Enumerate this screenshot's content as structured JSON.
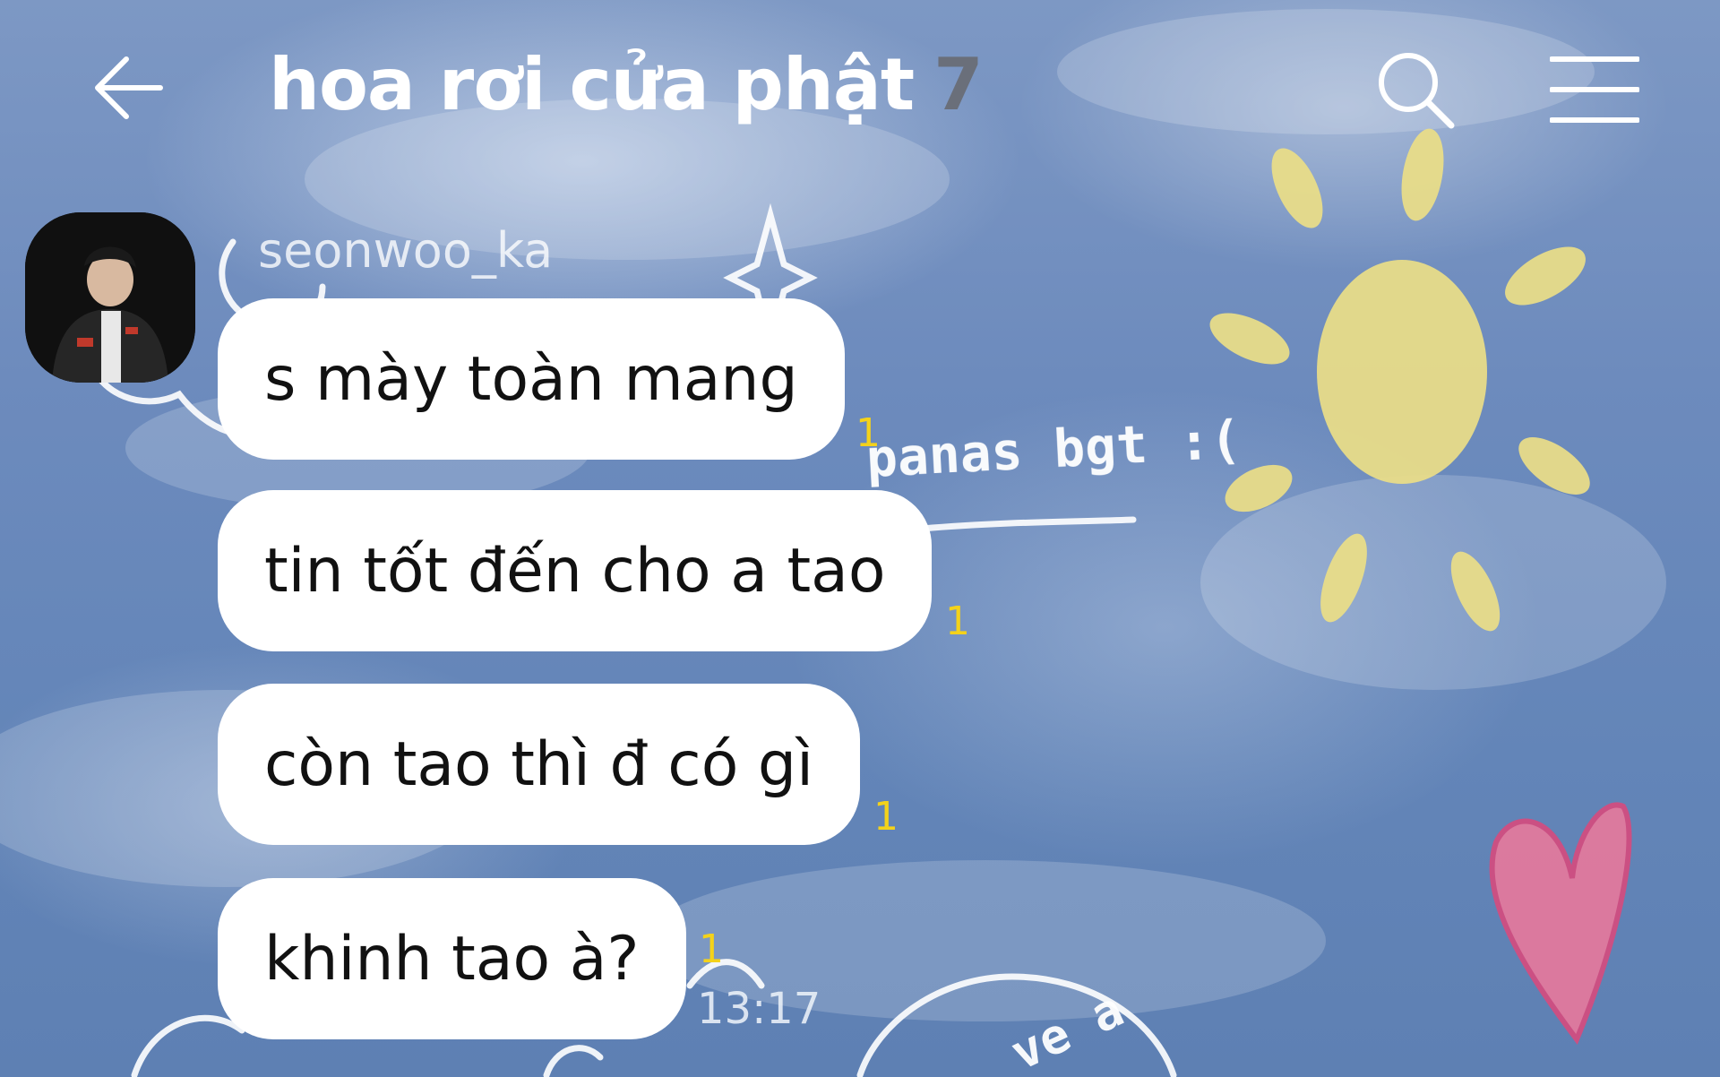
{
  "header": {
    "title": "hoa rơi cửa phật",
    "member_count": "7",
    "back_icon": "arrow-left-icon",
    "search_icon": "search-icon",
    "menu_icon": "hamburger-menu-icon"
  },
  "sender": {
    "name": "seonwoo_ka",
    "avatar_icon": "avatar"
  },
  "messages": [
    {
      "text": "s mày toàn mang",
      "unread": "1"
    },
    {
      "text": "tin tốt đến cho a tao",
      "unread": "1"
    },
    {
      "text": "còn tao thì đ có gì",
      "unread": "1"
    },
    {
      "text": "khinh tao à?",
      "unread": "1"
    }
  ],
  "last_time": "13:17",
  "wallpaper": {
    "doodle_text": "panas bgt :(",
    "doodle_text_2": "ve a"
  },
  "colors": {
    "unread": "#f4d21a",
    "bubble": "#ffffff",
    "member_count": "#6a6f7a"
  }
}
